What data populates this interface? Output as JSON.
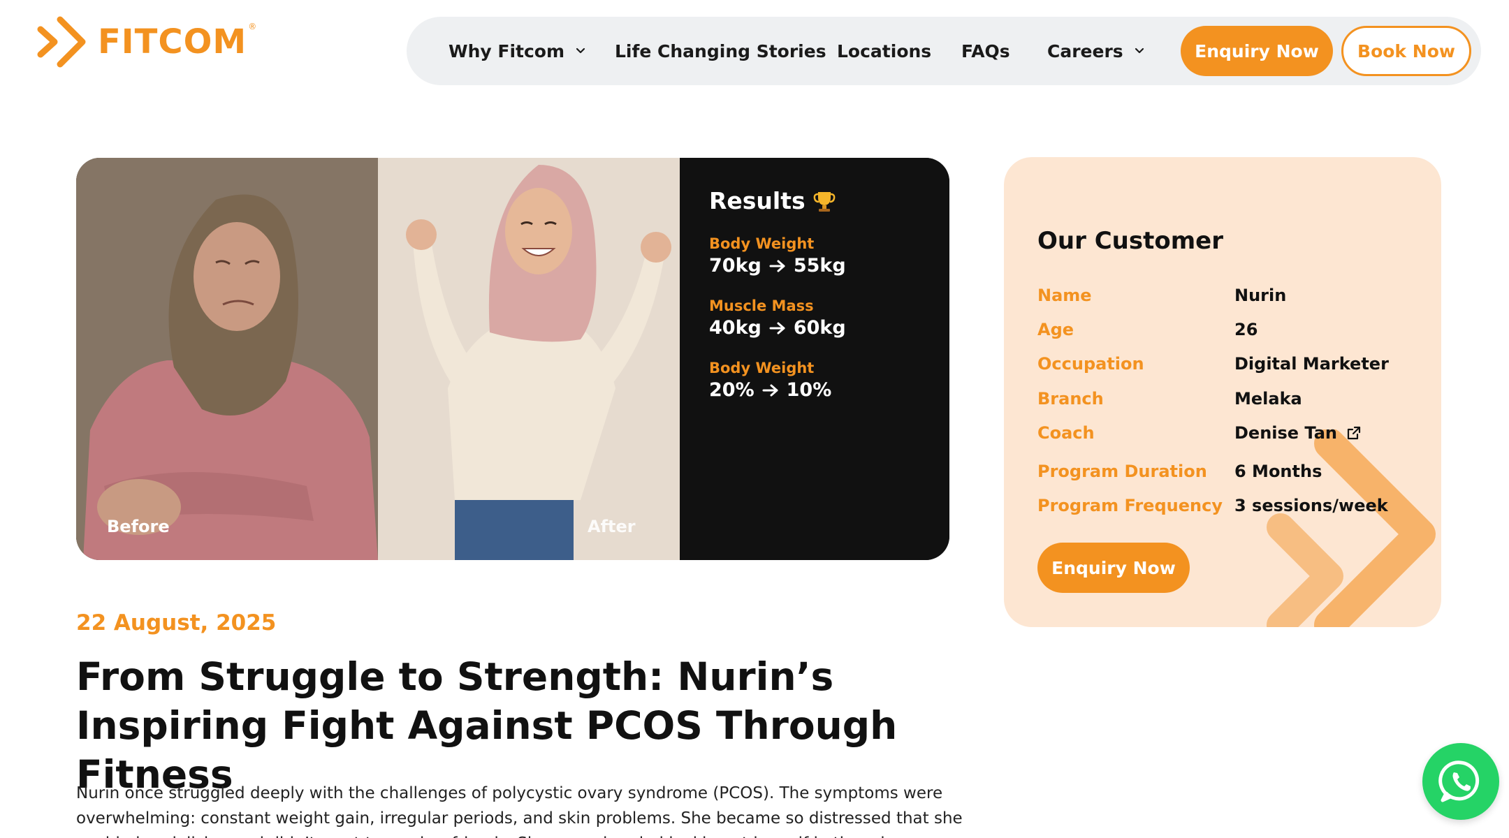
{
  "brand": {
    "name": "FITCOM",
    "reg": "®",
    "accent": "#f39220"
  },
  "nav": {
    "items": [
      {
        "label": "Why Fitcom",
        "has_dropdown": true
      },
      {
        "label": "Life Changing Stories",
        "has_dropdown": false
      },
      {
        "label": "Locations",
        "has_dropdown": false
      },
      {
        "label": "FAQs",
        "has_dropdown": false
      },
      {
        "label": "Careers",
        "has_dropdown": true
      }
    ],
    "enquiry_label": "Enquiry Now",
    "book_label": "Book Now"
  },
  "hero": {
    "before_label": "Before",
    "after_label": "After",
    "results": {
      "title": "Results",
      "title_icon": "trophy-icon",
      "items": [
        {
          "label": "Body Weight",
          "from": "70kg",
          "to": "55kg"
        },
        {
          "label": "Muscle Mass",
          "from": "40kg",
          "to": "60kg"
        },
        {
          "label": "Body Weight",
          "from": "20%",
          "to": "10%"
        }
      ]
    }
  },
  "customer": {
    "title": "Our Customer",
    "rows": [
      {
        "label": "Name",
        "value": "Nurin"
      },
      {
        "label": "Age",
        "value": "26"
      },
      {
        "label": "Occupation",
        "value": "Digital Marketer"
      },
      {
        "label": "Branch",
        "value": "Melaka"
      },
      {
        "label": "Coach",
        "value": "Denise Tan",
        "icon": "external-link-icon"
      },
      {
        "label": "Program Duration",
        "value": "6 Months"
      },
      {
        "label": "Program Frequency",
        "value": "3 sessions/week"
      }
    ],
    "enquiry_label": "Enquiry Now"
  },
  "article": {
    "date": "22 August, 2025",
    "title": "From Struggle to Strength: Nurin’s Inspiring Fight Against PCOS Through Fitness",
    "body": "Nurin once struggled deeply with the challenges of polycystic ovary syndrome (PCOS). The symptoms were overwhelming: constant weight gain, irregular periods, and skin problems. She became so distressed that she avoided socializing and didn’t want to see her friends. She even dreaded looking at herself in the mirror."
  },
  "whatsapp": {
    "icon": "whatsapp-icon",
    "color": "#25d366"
  }
}
